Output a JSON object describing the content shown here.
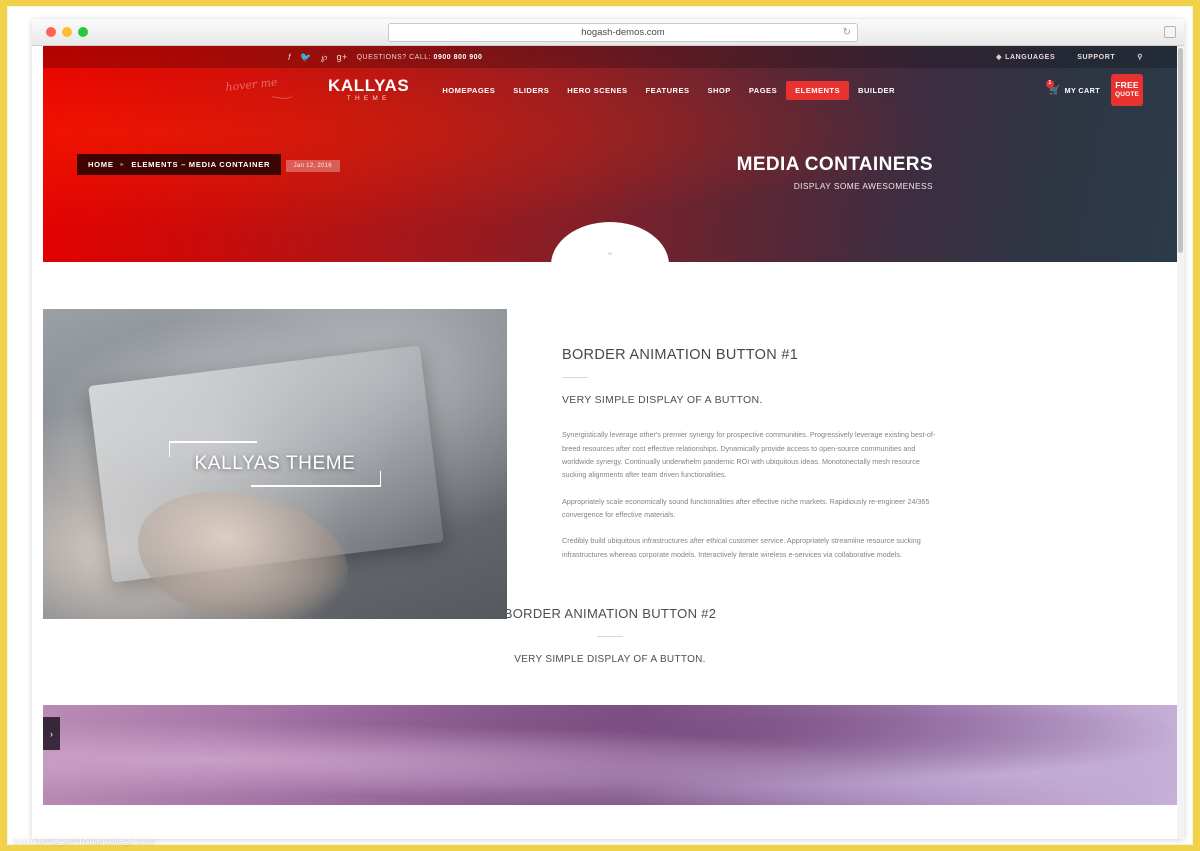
{
  "browser": {
    "url": "hogash-demos.com",
    "reload_icon": "reload-icon",
    "traffic_lights": [
      "close",
      "minimize",
      "maximize"
    ]
  },
  "topbar": {
    "social": [
      {
        "name": "facebook-icon",
        "glyph": "f"
      },
      {
        "name": "twitter-icon",
        "glyph": "✉"
      },
      {
        "name": "pinterest-icon",
        "glyph": "P"
      },
      {
        "name": "googleplus-icon",
        "glyph": "g+"
      }
    ],
    "call_label": "QUESTIONS? CALL:",
    "call_number": "0900 800 900",
    "languages_label": "LANGUAGES",
    "globe_icon": "globe-icon",
    "support_label": "SUPPORT",
    "search_icon": "search-icon"
  },
  "nav": {
    "hover_hint": "hover me",
    "logo_main": "KALLYAS",
    "logo_sub": "THEME",
    "links": [
      {
        "label": "HOMEPAGES",
        "active": false
      },
      {
        "label": "SLIDERS",
        "active": false
      },
      {
        "label": "HERO SCENES",
        "active": false
      },
      {
        "label": "FEATURES",
        "active": false
      },
      {
        "label": "SHOP",
        "active": false
      },
      {
        "label": "PAGES",
        "active": false
      },
      {
        "label": "ELEMENTS",
        "active": true
      },
      {
        "label": "BUILDER",
        "active": false
      }
    ],
    "cart_label": "MY CART",
    "cart_count": "1",
    "cart_icon": "shopping-cart-icon",
    "quote_line1": "FREE",
    "quote_line2": "QUOTE"
  },
  "hero": {
    "breadcrumb_home": "HOME",
    "breadcrumb_sep": "▸",
    "breadcrumb_current": "ELEMENTS – MEDIA CONTAINER",
    "date": "Jan 12, 2016",
    "title": "MEDIA CONTAINERS",
    "subtitle": "DISPLAY SOME AWESOMENESS",
    "scroll_chevron": "⌄",
    "accent_color": "#e8322f"
  },
  "section1": {
    "media_caption": "KALLYAS THEME",
    "heading": "BORDER ANIMATION BUTTON #1",
    "subheading": "VERY SIMPLE DISPLAY OF A BUTTON.",
    "paragraphs": [
      "Synergistically leverage other's premier synergy for prospective communities. Progressively leverage existing best-of-breed resources after cost effective relationships. Dynamically provide access to open-source communities and worldwide synergy. Continually underwhelm pandemic ROI with ubiquitous ideas. Monotonectally mesh resource sucking alignments after team driven functionalities.",
      "Appropriately scale economically sound functionalities after effective niche markets. Rapidiously re-engineer 24/365 convergence for effective materials.",
      "Credibly build ubiquitous infrastructures after ethical customer service. Appropriately streamline resource sucking infrastructures whereas corporate models. Interactively iterate wireless e-services via collaborative models."
    ]
  },
  "section2": {
    "heading": "BORDER ANIMATION BUTTON #2",
    "subheading": "VERY SIMPLE DISPLAY OF A BUTTON."
  },
  "section3": {
    "slider_next_arrow": "›"
  },
  "watermark": "www.heritagechristiancollege.com"
}
